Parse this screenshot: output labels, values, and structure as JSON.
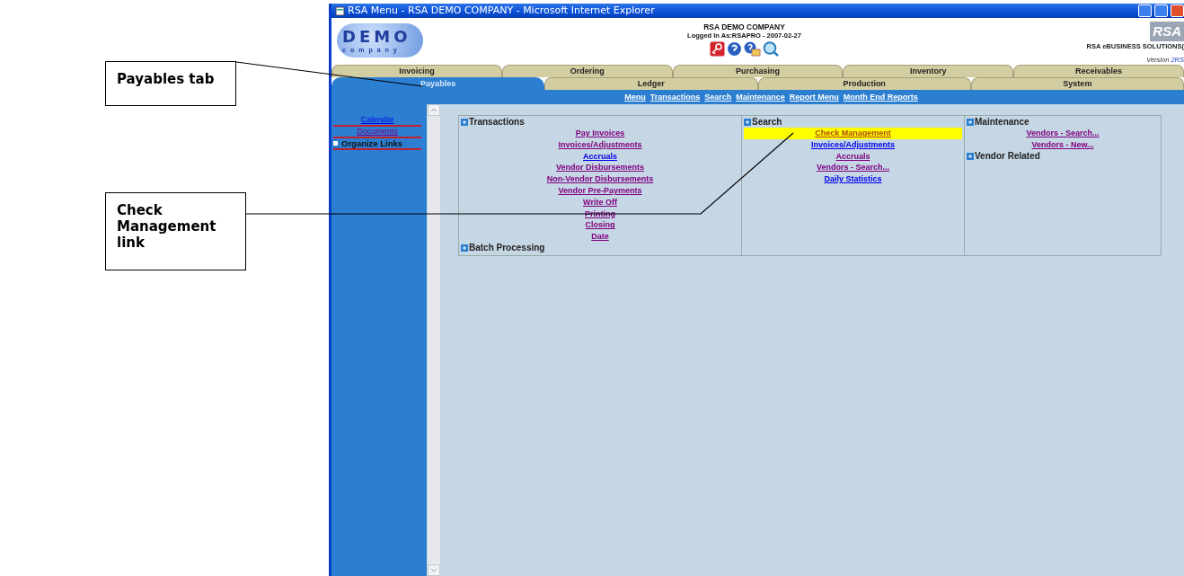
{
  "callouts": [
    {
      "text": "Payables tab"
    },
    {
      "text": "Check Management link"
    }
  ],
  "window": {
    "title": "RSA Menu - RSA DEMO COMPANY - Microsoft Internet Explorer"
  },
  "header": {
    "logo_word": "DEMO",
    "logo_sub": "company",
    "company": "RSA DEMO COMPANY",
    "login": "Logged In As:RSAPRO - 2007-02-27",
    "brand_logo": "RSA",
    "brand": "RSA eBUSINESS SOLUTIONS(",
    "version": "Version 2RS"
  },
  "tab_rows": [
    {
      "tabs": [
        {
          "label": "Invoicing",
          "selected": false
        },
        {
          "label": "Ordering",
          "selected": false
        },
        {
          "label": "Purchasing",
          "selected": false
        },
        {
          "label": "Inventory",
          "selected": false
        },
        {
          "label": "Receivables",
          "selected": false
        }
      ]
    },
    {
      "tabs": [
        {
          "label": "Payables",
          "selected": true
        },
        {
          "label": "Ledger",
          "selected": false
        },
        {
          "label": "Production",
          "selected": false
        },
        {
          "label": "System",
          "selected": false
        }
      ]
    }
  ],
  "menu_links": [
    "Menu",
    "Transactions",
    "Search",
    "Maintenance",
    "Report Menu",
    "Month End Reports"
  ],
  "sidebar": {
    "items": [
      {
        "label": "Calendar",
        "kind": "link",
        "visited": false
      },
      {
        "label": "Documents",
        "kind": "link",
        "visited": true
      },
      {
        "label": "Organize Links",
        "kind": "toggle"
      }
    ]
  },
  "columns": [
    {
      "sections": [
        {
          "title": "Transactions",
          "links": [
            {
              "label": "Pay Invoices",
              "visited": true,
              "highlighted": false
            },
            {
              "label": "Invoices/Adjustments",
              "visited": true,
              "highlighted": false
            },
            {
              "label": "Accruals",
              "visited": false,
              "highlighted": false
            },
            {
              "label": "Vendor Disbursements",
              "visited": true,
              "highlighted": false
            },
            {
              "label": "Non-Vendor Disbursements",
              "visited": true,
              "highlighted": false
            },
            {
              "label": "Vendor Pre-Payments",
              "visited": true,
              "highlighted": false
            },
            {
              "label": "Write Off",
              "visited": true,
              "highlighted": false
            },
            {
              "label": "Printing",
              "visited": true,
              "highlighted": false
            },
            {
              "label": "Closing",
              "visited": true,
              "highlighted": false
            },
            {
              "label": "Date",
              "visited": true,
              "highlighted": false
            }
          ]
        },
        {
          "title": "Batch Processing"
        }
      ]
    },
    {
      "sections": [
        {
          "title": "Search",
          "links": [
            {
              "label": "Check Management",
              "visited": true,
              "highlighted": true
            },
            {
              "label": "Invoices/Adjustments",
              "visited": false,
              "highlighted": false
            },
            {
              "label": "Accruals",
              "visited": true,
              "highlighted": false
            },
            {
              "label": "Vendors - Search...",
              "visited": true,
              "highlighted": false
            },
            {
              "label": "Daily Statistics",
              "visited": false,
              "highlighted": false
            }
          ]
        }
      ]
    },
    {
      "sections": [
        {
          "title": "Maintenance",
          "links": [
            {
              "label": "Vendors - Search...",
              "visited": true,
              "highlighted": false
            },
            {
              "label": "Vendors - New...",
              "visited": true,
              "highlighted": false
            }
          ]
        },
        {
          "title": "Vendor Related"
        }
      ]
    }
  ]
}
